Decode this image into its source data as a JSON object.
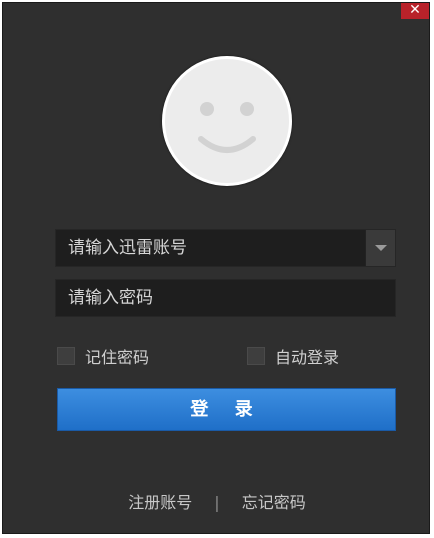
{
  "window": {
    "close_glyph": "✕"
  },
  "avatar": {
    "icon": "smiley-face-icon"
  },
  "login_form": {
    "account_placeholder": "请输入迅雷账号",
    "password_placeholder": "请输入密码",
    "remember_password_label": "记住密码",
    "auto_login_label": "自动登录",
    "login_button_label": "登 录"
  },
  "footer": {
    "register_label": "注册账号",
    "separator": "|",
    "forgot_password_label": "忘记密码"
  },
  "colors": {
    "background": "#2f2f2f",
    "field": "#1e1e1e",
    "accent": "#2a7fd6",
    "close": "#b8222a"
  }
}
